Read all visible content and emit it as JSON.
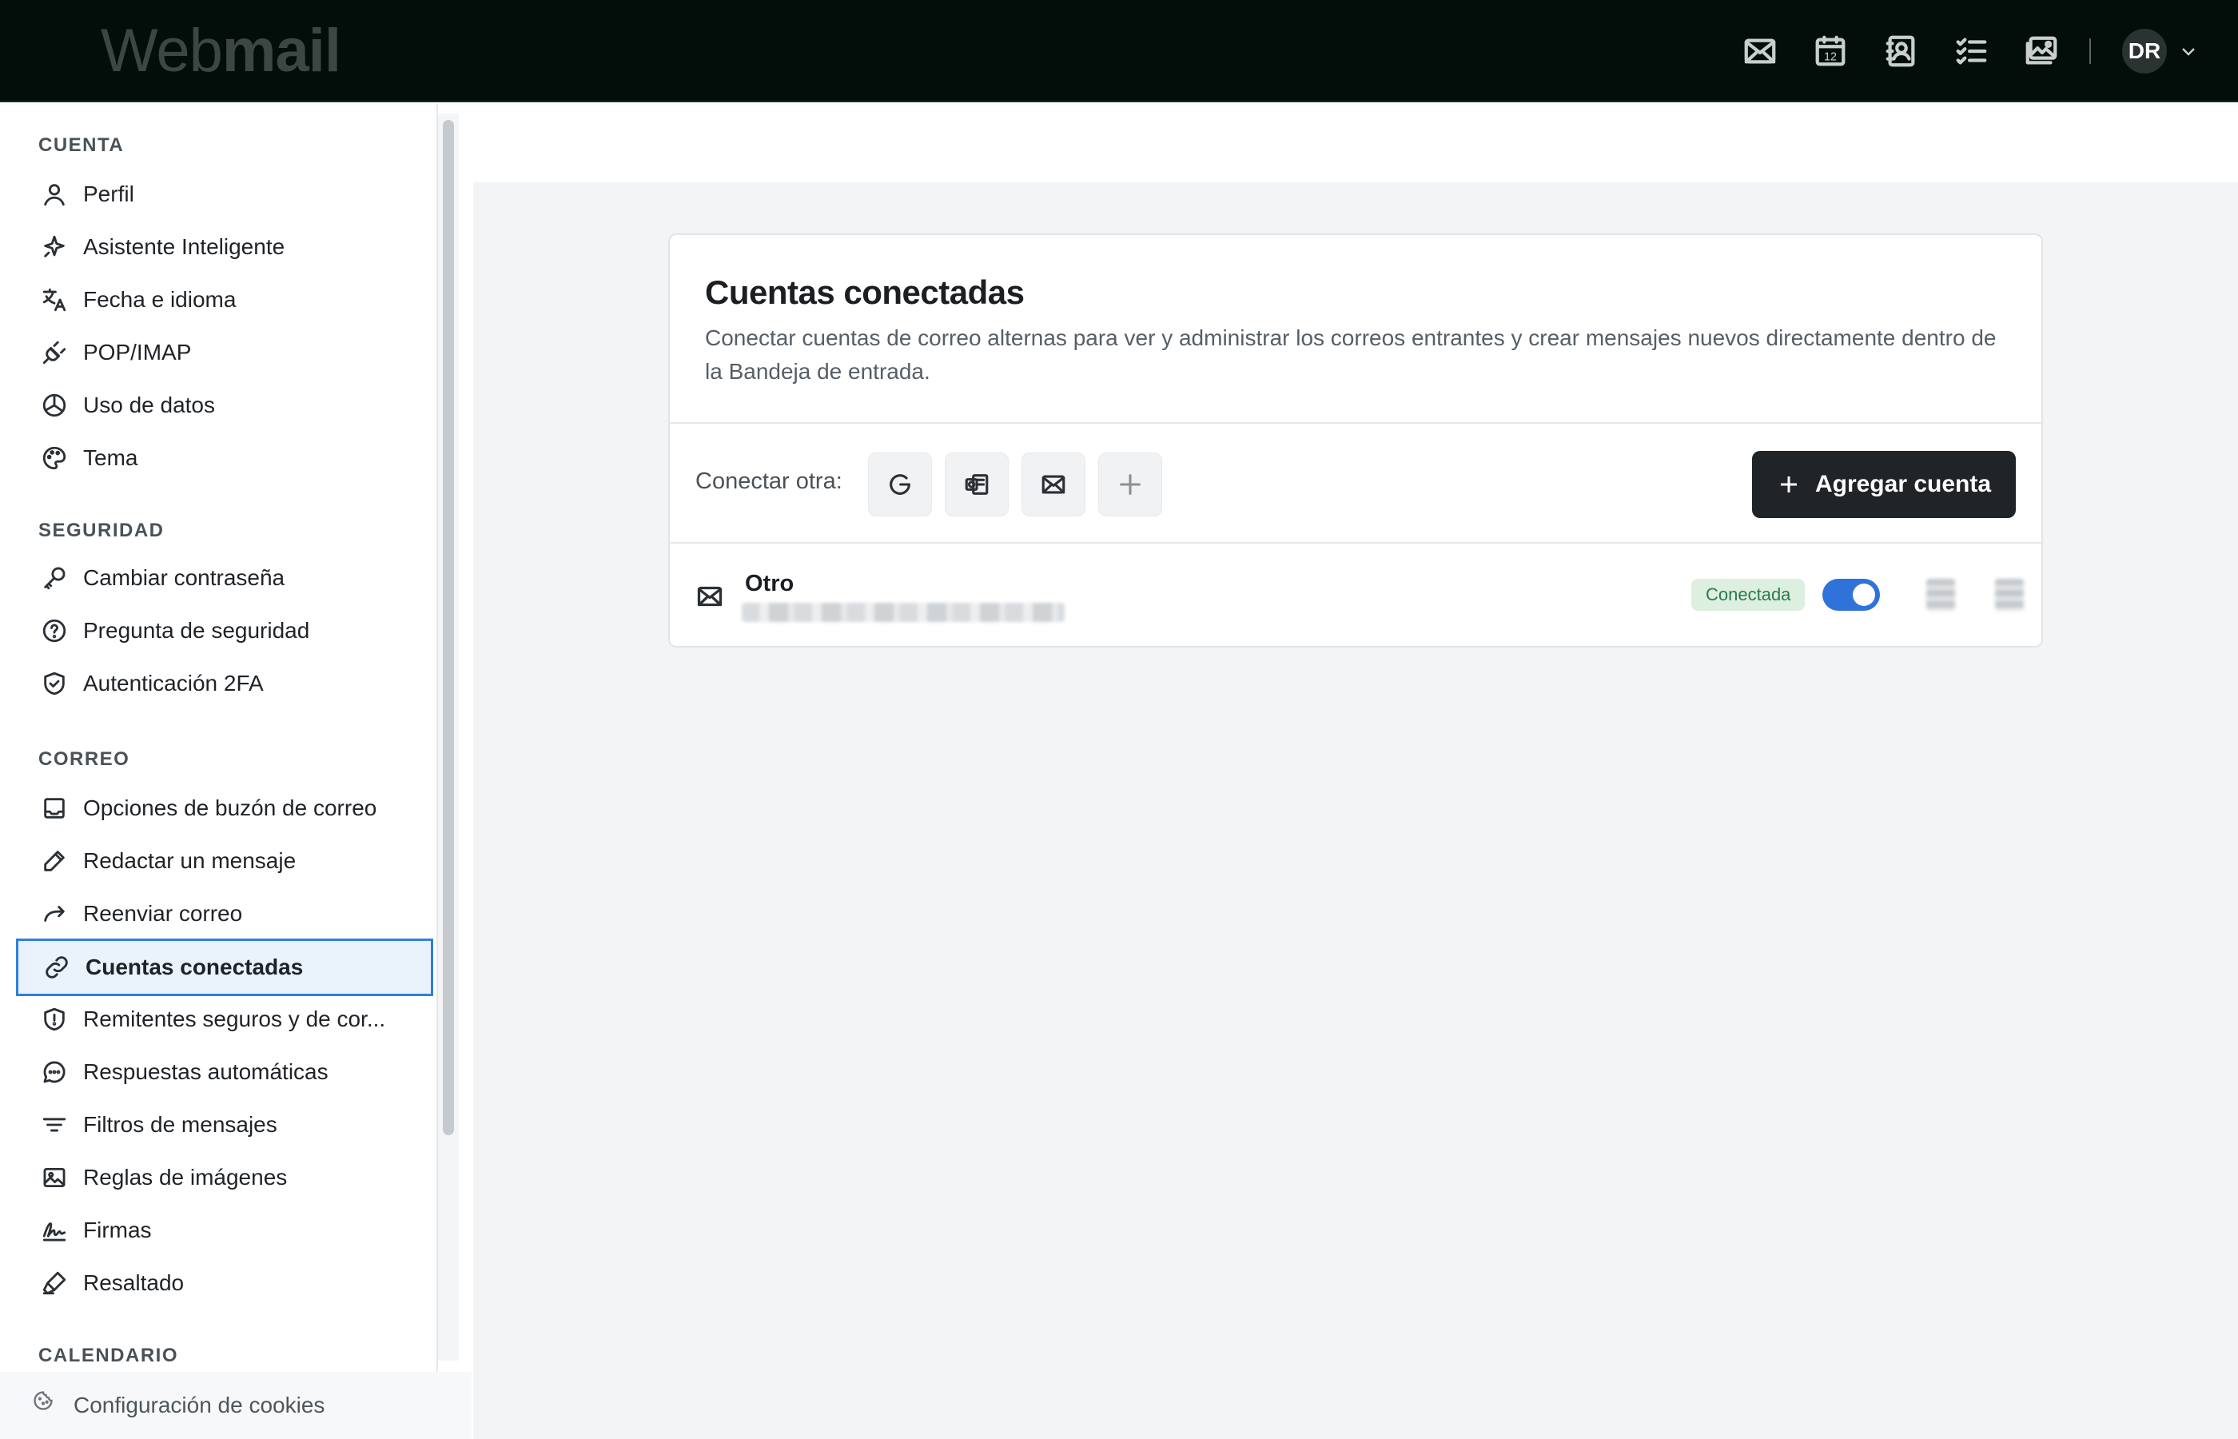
{
  "app": {
    "brand_light": "Web",
    "brand_bold": "mail",
    "user_initials": "DR"
  },
  "topbar": {
    "icons": [
      "mail-icon",
      "calendar-icon",
      "contacts-icon",
      "tasks-icon",
      "photos-icon"
    ],
    "calendar_day": "12"
  },
  "sidebar": {
    "sections": {
      "account": "CUENTA",
      "security": "SEGURIDAD",
      "mail": "CORREO",
      "calendar": "CALENDARIO"
    },
    "account_items": [
      {
        "label": "Perfil",
        "icon": "user-icon"
      },
      {
        "label": "Asistente Inteligente",
        "icon": "sparkle-icon"
      },
      {
        "label": "Fecha e idioma",
        "icon": "translate-icon"
      },
      {
        "label": "POP/IMAP",
        "icon": "plug-icon"
      },
      {
        "label": "Uso de datos",
        "icon": "pie-chart-icon"
      },
      {
        "label": "Tema",
        "icon": "palette-icon"
      }
    ],
    "security_items": [
      {
        "label": "Cambiar contraseña",
        "icon": "key-icon"
      },
      {
        "label": "Pregunta de seguridad",
        "icon": "question-icon"
      },
      {
        "label": "Autenticación 2FA",
        "icon": "shield-check-icon"
      }
    ],
    "mail_items": [
      {
        "label": "Opciones de buzón de correo",
        "icon": "inbox-icon"
      },
      {
        "label": "Redactar un mensaje",
        "icon": "pencil-icon"
      },
      {
        "label": "Reenviar correo",
        "icon": "forward-icon"
      },
      {
        "label": "Cuentas conectadas",
        "icon": "link-icon",
        "active": true
      },
      {
        "label": "Remitentes seguros y de cor...",
        "icon": "shield-alert-icon"
      },
      {
        "label": "Respuestas automáticas",
        "icon": "chat-icon"
      },
      {
        "label": "Filtros de mensajes",
        "icon": "filter-icon"
      },
      {
        "label": "Reglas de imágenes",
        "icon": "image-icon"
      },
      {
        "label": "Firmas",
        "icon": "signature-icon"
      },
      {
        "label": "Resaltado",
        "icon": "highlighter-icon"
      }
    ],
    "cookie_settings": "Configuración de cookies"
  },
  "main": {
    "title": "Cuentas conectadas",
    "description": "Conectar cuentas de correo alternas para ver y administrar los correos entrantes y crear mensajes nuevos directamente dentro de la Bandeja de entrada.",
    "connect_label": "Conectar otra:",
    "providers": [
      "google-icon",
      "outlook-icon",
      "mail-icon",
      "plus-icon"
    ],
    "add_account_label": "Agregar cuenta",
    "accounts": [
      {
        "name": "Otro",
        "status": "Conectada",
        "enabled": true
      }
    ]
  },
  "colors": {
    "topbar": "#030d0a",
    "accent": "#2f72d9",
    "active_nav_border": "#2f7fe0",
    "badge_bg": "#dcefe1",
    "badge_text": "#2c7a48",
    "primary_button": "#202427"
  }
}
